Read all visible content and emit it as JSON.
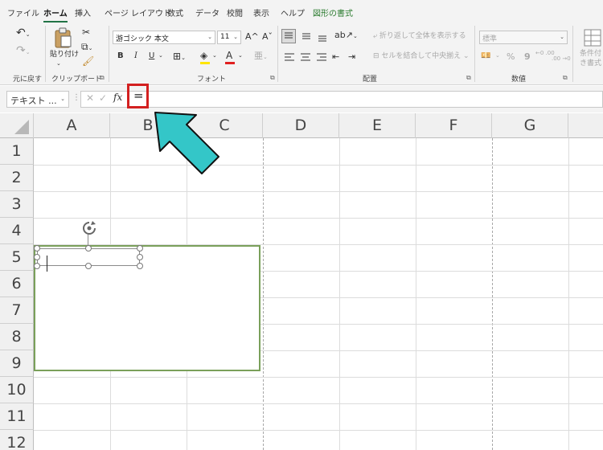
{
  "ribbon": {
    "tabs": [
      "ファイル",
      "ホーム",
      "挿入",
      "ページ レイアウト",
      "数式",
      "データ",
      "校閲",
      "表示",
      "ヘルプ",
      "図形の書式"
    ],
    "active_tab": "ホーム",
    "groups": {
      "undo": "元に戻す",
      "clipboard": "クリップボード",
      "font": "フォント",
      "alignment": "配置",
      "number": "数値"
    },
    "paste_label": "貼り付け",
    "font_name": "游ゴシック 本文",
    "font_size": "11",
    "grow_font": "A^",
    "shrink_font": "Aˇ",
    "wrap_text": "折り返して全体を表示する",
    "merge_center": "セルを結合して中央揃え",
    "number_format": "標準",
    "conditional_format": "条件付き書式",
    "bold": "B",
    "italic": "I",
    "underline": "U",
    "currency": "💴",
    "percent": "%",
    "comma": "9",
    "increase_decimal": "←0 .00",
    "decrease_decimal": ".00 →0"
  },
  "formula_bar": {
    "name_box": "テキスト ...",
    "cancel": "✕",
    "enter": "✓",
    "fx": "fx",
    "formula": "="
  },
  "sheet": {
    "columns": [
      "A",
      "B",
      "C",
      "D",
      "E",
      "F",
      "G"
    ],
    "rows": [
      "1",
      "2",
      "3",
      "4",
      "5",
      "6",
      "7",
      "8",
      "9",
      "10",
      "11",
      "12"
    ]
  },
  "colors": {
    "accent": "#217346",
    "highlight_box": "#d32020",
    "arrow": "#34c6c8",
    "shape_border": "#7aa05a",
    "font_color": "#e02020",
    "fill_color": "#ffe500"
  }
}
